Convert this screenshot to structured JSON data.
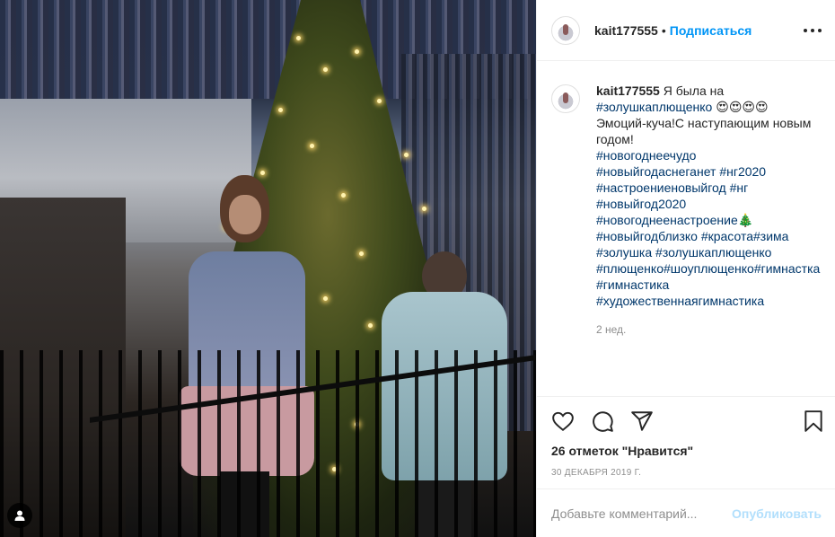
{
  "post": {
    "username": "kait177555",
    "separator": "•",
    "follow_label": "Подписаться",
    "more_icon": "more-horizontal-icon"
  },
  "caption": {
    "username": "kait177555",
    "lines": [
      {
        "text": " Я была на "
      },
      {
        "tag": "#золушкаплющенко"
      },
      {
        "text": " 😍😍😍😍"
      },
      {
        "text": "Эмоций-куча!С наступающим новым годом!"
      },
      {
        "tag": "#новогоднеечудо"
      },
      {
        "tag": "#новыйгодаснеганет"
      },
      {
        "tag": "#нг2020"
      },
      {
        "tag": "#настроениеновыйгод"
      },
      {
        "tag": "#нг"
      },
      {
        "tag": "#новыйгод2020"
      },
      {
        "tag": "#новогоднеенастроение"
      },
      {
        "text": "🎄"
      },
      {
        "tag": "#новыйгодблизко"
      },
      {
        "tag": "#красота"
      },
      {
        "tag": "#зима"
      },
      {
        "tag": "#золушка"
      },
      {
        "tag": "#золушкаплющенко"
      },
      {
        "tag": "#плющенко"
      },
      {
        "tag": "#шоуплющенко"
      },
      {
        "tag": "#гимнастка"
      },
      {
        "tag": "#гимнастика"
      },
      {
        "tag": "#художественнаягимнастика"
      }
    ],
    "time": "2 нед."
  },
  "actions": {
    "like_icon": "heart-icon",
    "comment_icon": "comment-icon",
    "share_icon": "share-icon",
    "save_icon": "bookmark-icon",
    "likes_text": "26 отметок \"Нравится\"",
    "date": "30 ДЕКАБРЯ 2019 Г."
  },
  "comment": {
    "placeholder": "Добавьте комментарий...",
    "publish_label": "Опубликовать"
  },
  "photo": {
    "user_tag_icon": "user-icon"
  }
}
